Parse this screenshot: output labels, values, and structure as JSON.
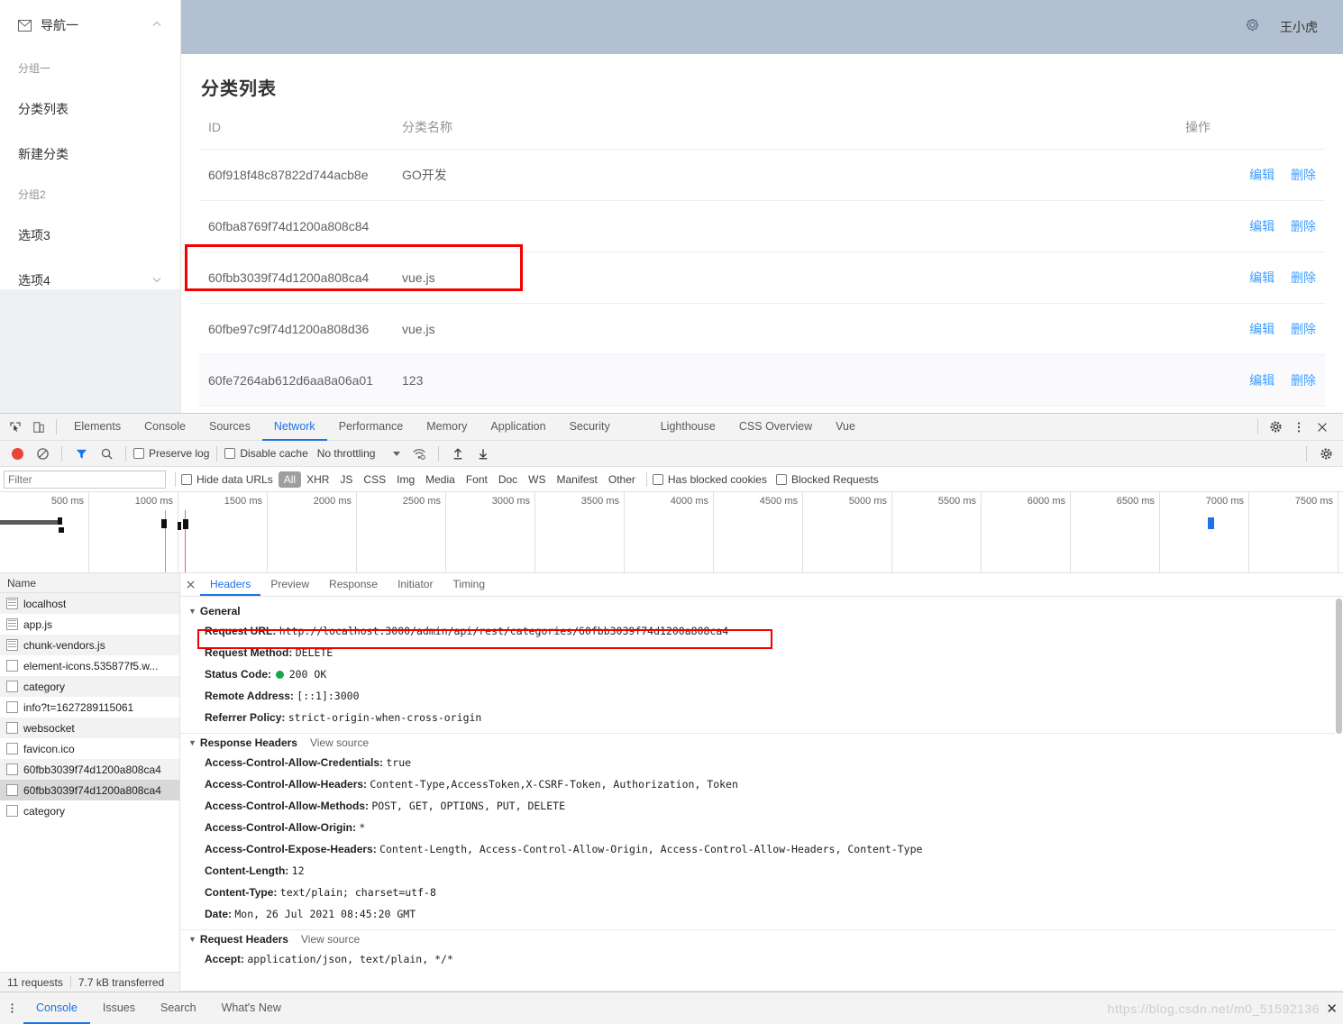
{
  "app": {
    "sidebar": {
      "top": {
        "label": "导航一",
        "icon": "mail-icon",
        "arrow": "chevron-up-icon"
      },
      "groups": [
        {
          "title": "分组一",
          "items": [
            {
              "label": "分类列表"
            },
            {
              "label": "新建分类"
            }
          ]
        },
        {
          "title": "分组2",
          "items": [
            {
              "label": "选项3"
            },
            {
              "label": "选项4",
              "arrow": "chevron-down-icon"
            }
          ]
        }
      ]
    },
    "header": {
      "gear_icon": "gear-icon",
      "user_name": "王小虎"
    },
    "page_title": "分类列表",
    "table": {
      "columns": [
        "ID",
        "分类名称",
        "操作"
      ],
      "rows": [
        {
          "id": "60f918f48c87822d744acb8e",
          "name": "GO开发",
          "edit": "编辑",
          "delete": "删除"
        },
        {
          "id": "60fba8769f74d1200a808c84",
          "name": "",
          "edit": "编辑",
          "delete": "删除"
        },
        {
          "id": "60fbb3039f74d1200a808ca4",
          "name": "vue.js",
          "edit": "编辑",
          "delete": "删除"
        },
        {
          "id": "60fbe97c9f74d1200a808d36",
          "name": "vue.js",
          "edit": "编辑",
          "delete": "删除"
        },
        {
          "id": "60fe7264ab612d6aa8a06a01",
          "name": "123",
          "edit": "编辑",
          "delete": "删除"
        }
      ]
    }
  },
  "devtools": {
    "main_tabs": [
      "Elements",
      "Console",
      "Sources",
      "Network",
      "Performance",
      "Memory",
      "Application",
      "Security",
      "Lighthouse",
      "CSS Overview",
      "Vue"
    ],
    "active_main_tab": "Network",
    "toolbar": {
      "record_icon": "record-icon",
      "clear_icon": "clear-icon",
      "filter_icon": "filter-icon",
      "search_icon": "search-icon",
      "preserve_log": "Preserve log",
      "disable_cache": "Disable cache",
      "throttling": "No throttling",
      "wifi_icon": "network-conditions-icon",
      "import_icon": "import-har-icon",
      "export_icon": "export-har-icon",
      "settings_icon": "gear-icon",
      "more_icon": "kebab-menu-icon",
      "close_icon": "close-icon"
    },
    "filterbar": {
      "filter_placeholder": "Filter",
      "hide_data_urls": "Hide data URLs",
      "types": [
        "All",
        "XHR",
        "JS",
        "CSS",
        "Img",
        "Media",
        "Font",
        "Doc",
        "WS",
        "Manifest",
        "Other"
      ],
      "active_type": "All",
      "has_blocked_cookies": "Has blocked cookies",
      "blocked_requests": "Blocked Requests"
    },
    "timeline": {
      "ticks": [
        "500 ms",
        "1000 ms",
        "1500 ms",
        "2000 ms",
        "2500 ms",
        "3000 ms",
        "3500 ms",
        "4000 ms",
        "4500 ms",
        "5000 ms",
        "5500 ms",
        "6000 ms",
        "6500 ms",
        "7000 ms",
        "7500 ms"
      ]
    },
    "request_list": {
      "header": "Name",
      "items": [
        {
          "name": "localhost",
          "icon": "document-icon"
        },
        {
          "name": "app.js",
          "icon": "document-icon"
        },
        {
          "name": "chunk-vendors.js",
          "icon": "document-icon"
        },
        {
          "name": "element-icons.535877f5.w...",
          "icon": "file-icon"
        },
        {
          "name": "category",
          "icon": "file-icon"
        },
        {
          "name": "info?t=1627289115061",
          "icon": "file-icon"
        },
        {
          "name": "websocket",
          "icon": "file-icon"
        },
        {
          "name": "favicon.ico",
          "icon": "file-icon"
        },
        {
          "name": "60fbb3039f74d1200a808ca4",
          "icon": "file-icon"
        },
        {
          "name": "60fbb3039f74d1200a808ca4",
          "icon": "file-icon",
          "selected": true
        },
        {
          "name": "category",
          "icon": "file-icon"
        }
      ]
    },
    "detail_tabs": [
      "Headers",
      "Preview",
      "Response",
      "Initiator",
      "Timing"
    ],
    "active_detail_tab": "Headers",
    "sections": {
      "general": {
        "title": "General",
        "rows": [
          {
            "key": "Request URL:",
            "value": "http://localhost:3000/admin/api/rest/categories/60fbb3039f74d1200a808ca4",
            "highlight": true
          },
          {
            "key": "Request Method:",
            "value": "DELETE"
          },
          {
            "key": "Status Code:",
            "value": "200 OK",
            "status_dot": "#19a54b"
          },
          {
            "key": "Remote Address:",
            "value": "[::1]:3000"
          },
          {
            "key": "Referrer Policy:",
            "value": "strict-origin-when-cross-origin"
          }
        ]
      },
      "response_headers": {
        "title": "Response Headers",
        "view_source": "View source",
        "rows": [
          {
            "key": "Access-Control-Allow-Credentials:",
            "value": "true"
          },
          {
            "key": "Access-Control-Allow-Headers:",
            "value": "Content-Type,AccessToken,X-CSRF-Token, Authorization, Token"
          },
          {
            "key": "Access-Control-Allow-Methods:",
            "value": "POST, GET, OPTIONS, PUT, DELETE"
          },
          {
            "key": "Access-Control-Allow-Origin:",
            "value": "*"
          },
          {
            "key": "Access-Control-Expose-Headers:",
            "value": "Content-Length, Access-Control-Allow-Origin, Access-Control-Allow-Headers, Content-Type"
          },
          {
            "key": "Content-Length:",
            "value": "12"
          },
          {
            "key": "Content-Type:",
            "value": "text/plain; charset=utf-8"
          },
          {
            "key": "Date:",
            "value": "Mon, 26 Jul 2021 08:45:20 GMT"
          }
        ]
      },
      "request_headers": {
        "title": "Request Headers",
        "view_source": "View source",
        "rows": [
          {
            "key": "Accept:",
            "value": "application/json, text/plain, */*"
          }
        ]
      }
    },
    "status": {
      "requests": "11 requests",
      "transferred": "7.7 kB transferred"
    },
    "drawer": {
      "tabs": [
        "Console",
        "Issues",
        "Search",
        "What's New"
      ],
      "active": "Console"
    },
    "watermark": "https://blog.csdn.net/m0_51592136"
  }
}
